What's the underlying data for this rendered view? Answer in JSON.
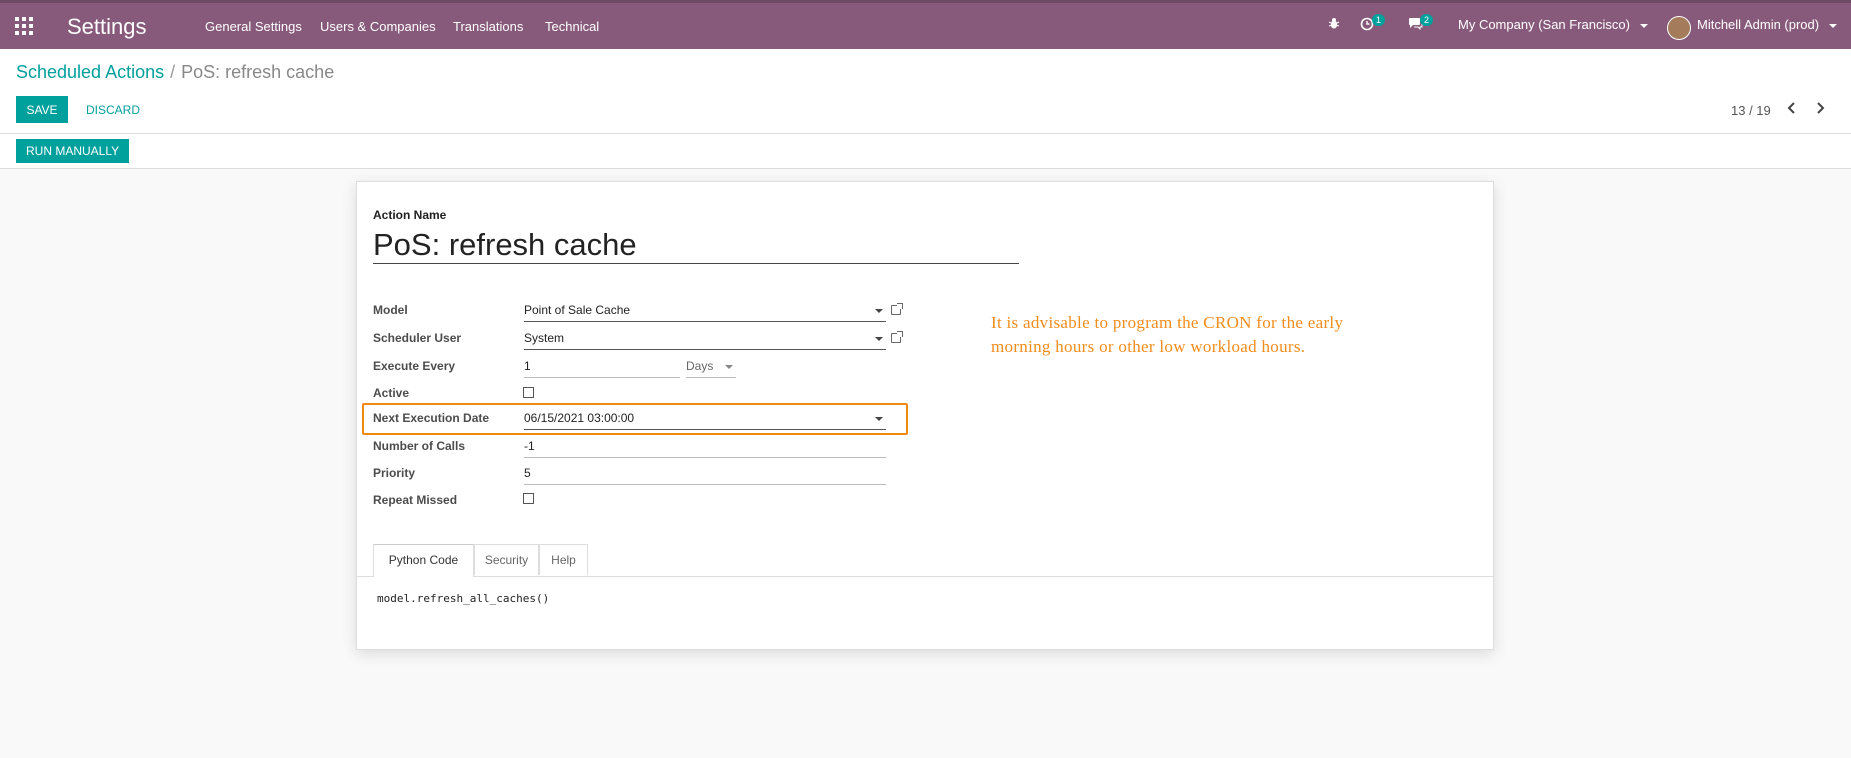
{
  "app": {
    "title": "Settings"
  },
  "menu": [
    "General Settings",
    "Users & Companies",
    "Translations",
    "Technical"
  ],
  "systray": {
    "activity_count": "1",
    "message_count": "2",
    "company": "My Company (San Francisco)",
    "user": "Mitchell Admin (prod)"
  },
  "breadcrumb": {
    "parent": "Scheduled Actions",
    "separator": "/",
    "current": "PoS: refresh cache"
  },
  "buttons": {
    "save": "SAVE",
    "discard": "DISCARD",
    "run_manually": "RUN MANUALLY"
  },
  "pager": {
    "text": "13 / 19"
  },
  "form": {
    "name_label": "Action Name",
    "name_value": "PoS: refresh cache",
    "fields": {
      "model": {
        "label": "Model",
        "value": "Point of Sale Cache"
      },
      "user": {
        "label": "Scheduler User",
        "value": "System"
      },
      "interval": {
        "label": "Execute Every",
        "value": "1",
        "unit": "Days"
      },
      "active": {
        "label": "Active",
        "checked": false
      },
      "nextcall": {
        "label": "Next Execution Date",
        "value": "06/15/2021 03:00:00"
      },
      "numbercall": {
        "label": "Number of Calls",
        "value": "-1"
      },
      "priority": {
        "label": "Priority",
        "value": "5"
      },
      "doall": {
        "label": "Repeat Missed",
        "checked": false
      }
    }
  },
  "note": "It is advisable to program the CRON for the early morning hours or other low workload hours.",
  "tabs": [
    {
      "label": "Python Code",
      "active": true
    },
    {
      "label": "Security",
      "active": false
    },
    {
      "label": "Help",
      "active": false
    }
  ],
  "code": "model.refresh_all_caches()",
  "colors": {
    "topbar": "#875a7b",
    "accent": "#00a09d",
    "highlight": "#f0890f",
    "note": "#f28c1b"
  }
}
